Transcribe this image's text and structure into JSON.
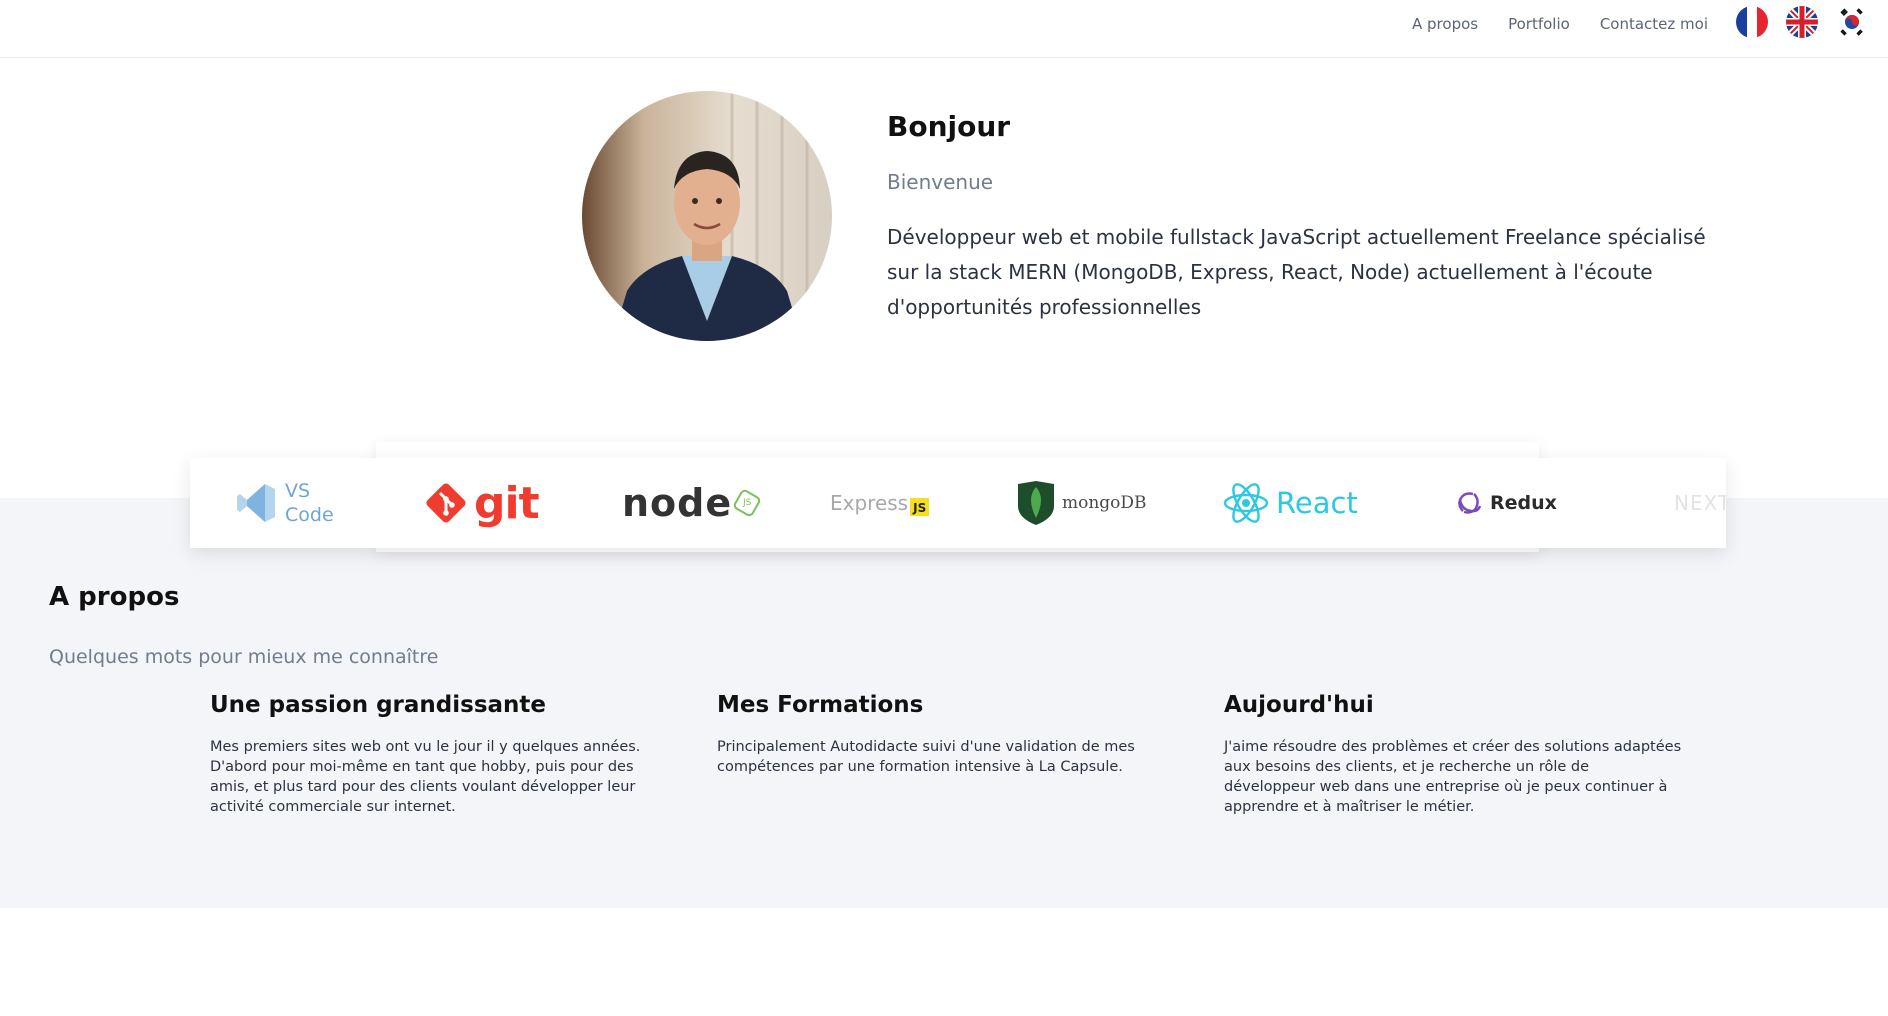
{
  "nav": {
    "links": [
      "A propos",
      "Portfolio",
      "Contactez moi"
    ],
    "flags": [
      "french-flag",
      "uk-flag",
      "korean-flag"
    ]
  },
  "hero": {
    "greeting": "Bonjour",
    "subgreeting": "Bienvenue",
    "intro": "Développeur web et mobile fullstack JavaScript actuellement Freelance spécialisé sur la stack MERN (MongoDB, Express, React, Node) actuellement à l'écoute d'opportunités professionnelles"
  },
  "tech": {
    "vscode": [
      "VS",
      "Code"
    ],
    "git": "git",
    "node": "node",
    "node_badge": "JS",
    "express": "Express",
    "express_badge": "JS",
    "mongodb": "mongoDB",
    "react": "React",
    "redux": "Redux",
    "next": "NEXT"
  },
  "about": {
    "title": "A propos",
    "subtitle": "Quelques mots pour mieux me connaître",
    "columns": [
      {
        "title": "Une passion grandissante",
        "text": "Mes premiers sites web ont vu le jour il y quelques années. D'abord pour moi-même en tant que hobby, puis pour des amis, et plus tard pour des clients voulant développer leur activité commerciale sur internet."
      },
      {
        "title": "Mes Formations",
        "text": "Principalement Autodidacte suivi d'une validation de mes compétences par une formation intensive à La Capsule."
      },
      {
        "title": "Aujourd'hui",
        "text": "J'aime résoudre des problèmes et créer des solutions adaptées aux besoins des clients, et je recherche un rôle de développeur web dans une entreprise où je peux continuer à apprendre et à maîtriser le métier."
      }
    ]
  },
  "colors": {
    "grey_band": "#f4f5f8",
    "nav_text": "#5c6578",
    "muted": "#717c8e",
    "git_orange": "#f03c2e",
    "react_cyan": "#2fc7e6",
    "mongo_green": "#3f9a3a",
    "redux_purple": "#764abc"
  }
}
